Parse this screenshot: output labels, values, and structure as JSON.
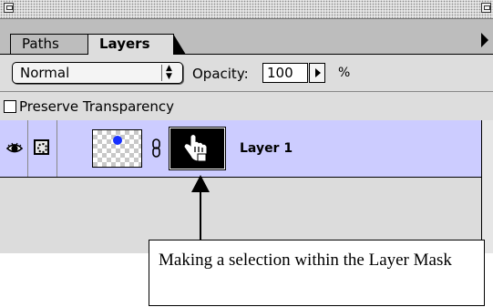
{
  "palette": {
    "title_buttons": {
      "close": "close-box",
      "zoom": "zoom-box"
    },
    "tabs": [
      {
        "label": "Paths",
        "active": false
      },
      {
        "label": "Layers",
        "active": true
      }
    ],
    "blend_mode": {
      "selected": "Normal",
      "options_icon": "up-down-arrows"
    },
    "opacity": {
      "label": "Opacity:",
      "value": "100",
      "unit": "%"
    },
    "preserve_transparency": {
      "label": "Preserve Transparency",
      "checked": false
    },
    "layers": [
      {
        "name": "Layer 1",
        "visible": true,
        "selected": true,
        "mode_icon": "mask-mode-icon",
        "thumbnail": "checkerboard-with-blue-dot",
        "linked": true,
        "mask_thumbnail": "black-mask-with-hand-cursor"
      }
    ]
  },
  "annotation": {
    "caption": "Making a selection within the Layer Mask"
  },
  "colors": {
    "selected_row": "#ccccff",
    "panel_bg": "#dddddd",
    "content_dot": "#1630ff"
  }
}
